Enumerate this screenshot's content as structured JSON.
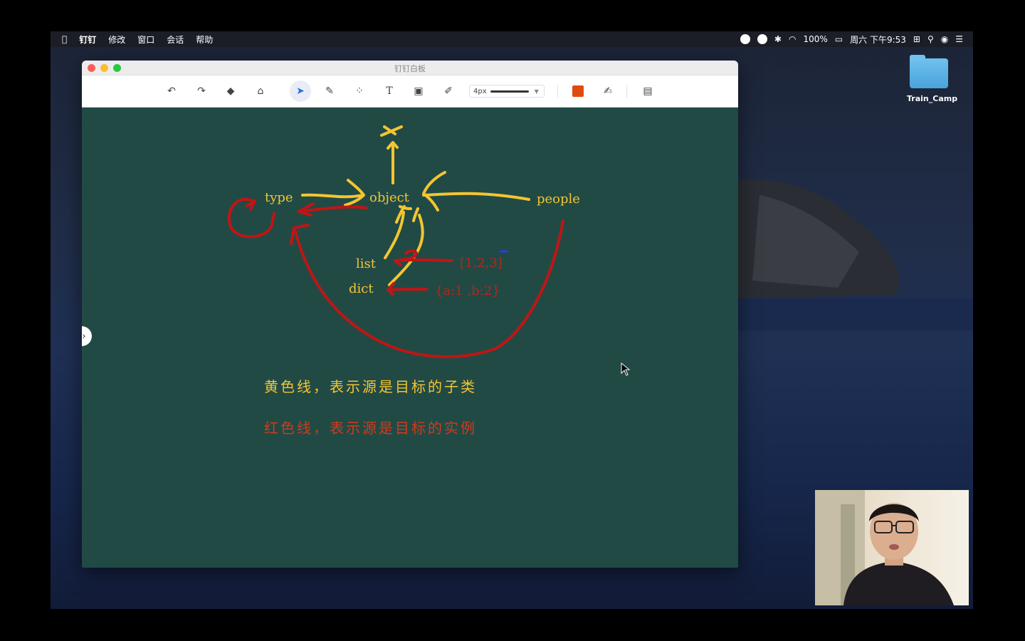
{
  "menubar": {
    "app_menus": [
      "钉钉",
      "修改",
      "窗口",
      "会话",
      "帮助"
    ],
    "battery": "100%",
    "datetime": "周六 下午9:53"
  },
  "desktop": {
    "folder_label": "Train_Camp"
  },
  "window": {
    "title": "钉钉白板",
    "toolbar": {
      "tools": [
        "undo-icon",
        "redo-icon",
        "eraser-icon",
        "clear-icon",
        "select-icon",
        "pen-icon",
        "shapes-icon",
        "text-icon",
        "image-icon",
        "highlighter-icon"
      ],
      "stroke_width": "4px",
      "color": "#e04a0f"
    }
  },
  "whiteboard": {
    "labels": {
      "type": "type",
      "object": "object",
      "people": "people",
      "list": "list",
      "dict": "dict",
      "list_literal": "[1,2,3]",
      "dict_literal": "{a:1 ,b:2}"
    },
    "caption_yellow": "黄色线，表示源是目标的子类",
    "caption_red": "红色线，表示源是目标的实例",
    "colors": {
      "yellow": "#f4c531",
      "red": "#c01515",
      "caption_red": "#d2391a"
    }
  }
}
